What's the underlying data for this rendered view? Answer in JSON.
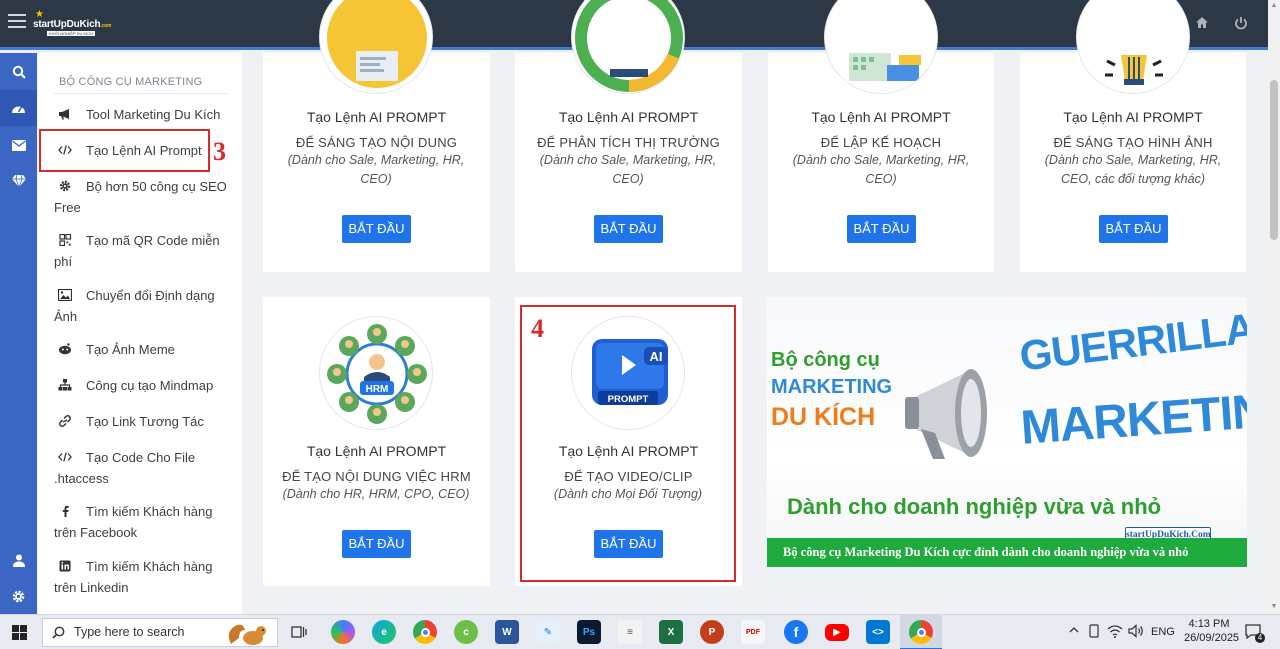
{
  "header": {
    "logo_text": "startUpDuKich",
    "logo_suffix": ".com",
    "logo_tagline": "KHỞI NGHIỆP DU KÍCH"
  },
  "sidebar": {
    "heading": "BỘ CÔNG CỤ MARKETING",
    "items": [
      {
        "label": "Tool Marketing Du Kích",
        "icon": "megaphone-icon"
      },
      {
        "label": "Tạo Lệnh AI Prompt",
        "icon": "code-icon"
      },
      {
        "label": "Bộ hơn 50 công cụ SEO Free",
        "icon": "gear-icon"
      },
      {
        "label": "Tạo mã QR Code miễn phí",
        "icon": "qr-icon"
      },
      {
        "label": "Chuyển đổi Định dạng Ảnh",
        "icon": "image-icon"
      },
      {
        "label": "Tạo Ảnh Meme",
        "icon": "reddit-icon"
      },
      {
        "label": "Công cụ tạo Mindmap",
        "icon": "sitemap-icon"
      },
      {
        "label": "Tạo Link Tương Tác",
        "icon": "link-icon"
      },
      {
        "label": "Tạo Code Cho File .htaccess",
        "icon": "code-icon"
      },
      {
        "label": "Tìm kiếm Khách hàng trên Facebook",
        "icon": "facebook-icon"
      },
      {
        "label": "Tìm kiếm Khách hàng trên Linkedin",
        "icon": "linkedin-icon"
      }
    ]
  },
  "annotations": {
    "three": "3",
    "four": "4"
  },
  "cards": [
    {
      "title": "Tạo Lệnh AI PROMPT",
      "subtitle": "ĐỂ SÁNG TẠO NỘI DUNG",
      "audience": "(Dành cho Sale, Marketing, HR, CEO)",
      "button": "BẮT ĐẦU"
    },
    {
      "title": "Tạo Lệnh AI PROMPT",
      "subtitle": "ĐỂ PHÂN TÍCH THỊ TRƯỜNG",
      "audience": "(Dành cho Sale, Marketing, HR, CEO)",
      "button": "BẮT ĐẦU"
    },
    {
      "title": "Tạo Lệnh AI PROMPT",
      "subtitle": "ĐỂ LẬP KẾ HOẠCH",
      "audience": "(Dành cho Sale, Marketing, HR, CEO)",
      "button": "BẮT ĐẦU"
    },
    {
      "title": "Tạo Lệnh AI PROMPT",
      "subtitle": "ĐỂ SÁNG TẠO HÌNH ẢNH",
      "audience": "(Dành cho Sale, Marketing, HR, CEO, các đối tượng khác)",
      "button": "BẮT ĐẦU"
    },
    {
      "title": "Tạo Lệnh AI PROMPT",
      "subtitle": "ĐỂ TẠO NỘI DUNG VIỆC HRM",
      "audience": "(Dành cho HR, HRM, CPO, CEO)",
      "button": "BẮT ĐẦU",
      "icon_label": "HRM"
    },
    {
      "title": "Tạo Lệnh AI PROMPT",
      "subtitle": "ĐỂ TẠO VIDEO/CLIP",
      "audience": "(Dành cho Mọi Đối Tượng)",
      "button": "BẮT ĐẦU",
      "icon_label": "PROMPT",
      "icon_badge": "AI"
    }
  ],
  "banner": {
    "line1": "Bộ công cụ",
    "line2": "MARKETING",
    "line3": "DU KÍCH",
    "big1": "GUERRILLA",
    "big2": "MARKETING",
    "tagline": "Dành cho doanh nghiệp vừa và nhỏ",
    "badge": "startUpDuKich.Com",
    "strip": "Bộ công cụ Marketing Du Kích cực đỉnh dành cho doanh nghiệp vừa và nhỏ"
  },
  "taskbar": {
    "search_placeholder": "Type here to search",
    "language": "ENG",
    "time": "4:13 PM",
    "date": "26/09/2025",
    "notification_count": "4"
  },
  "colors": {
    "accent": "#1e74e8",
    "rail": "#3c66c4",
    "header": "#2c3845",
    "annotation": "#d52b2b"
  }
}
